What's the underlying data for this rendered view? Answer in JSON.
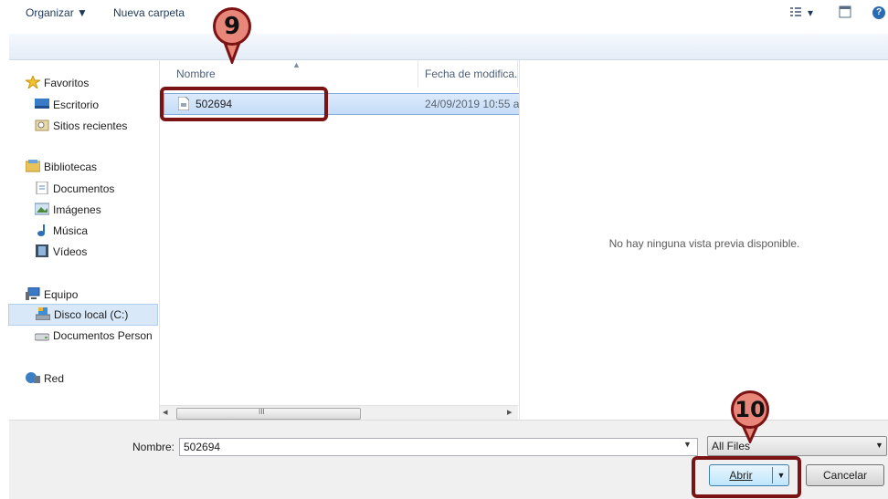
{
  "toolbar": {
    "organize_label": "Organizar ▼",
    "new_folder_label": "Nueva carpeta",
    "view_label": "▾",
    "help_label": "?"
  },
  "nav": {
    "favorites": {
      "label": "Favoritos",
      "items": [
        {
          "label": "Escritorio"
        },
        {
          "label": "Sitios recientes"
        }
      ]
    },
    "libraries": {
      "label": "Bibliotecas",
      "items": [
        {
          "label": "Documentos"
        },
        {
          "label": "Imágenes"
        },
        {
          "label": "Música"
        },
        {
          "label": "Vídeos"
        }
      ]
    },
    "computer": {
      "label": "Equipo",
      "items": [
        {
          "label": "Disco local (C:)",
          "selected": true
        },
        {
          "label": "Documentos Person"
        }
      ]
    },
    "network": {
      "label": "Red"
    }
  },
  "file_list": {
    "columns": [
      "Nombre",
      "Fecha de modifica."
    ],
    "rows": [
      {
        "name": "502694",
        "date": "24/09/2019 10:55 a.",
        "selected": true
      }
    ],
    "scroll_left": "◂",
    "scroll_right": "▸",
    "scroll_grip": "III"
  },
  "preview": {
    "message": "No hay ninguna vista previa disponible."
  },
  "bottom": {
    "filename_label": "Nombre:",
    "filename_value": "502694",
    "filter_value": "All Files",
    "open_label": "Abrir",
    "cancel_label": "Cancelar"
  },
  "annotations": {
    "marker_1": "9",
    "marker_2": "10"
  },
  "colors": {
    "annotation": "#7b1314",
    "marker_fill": "#e88779",
    "selection": "#c4dcf7"
  }
}
